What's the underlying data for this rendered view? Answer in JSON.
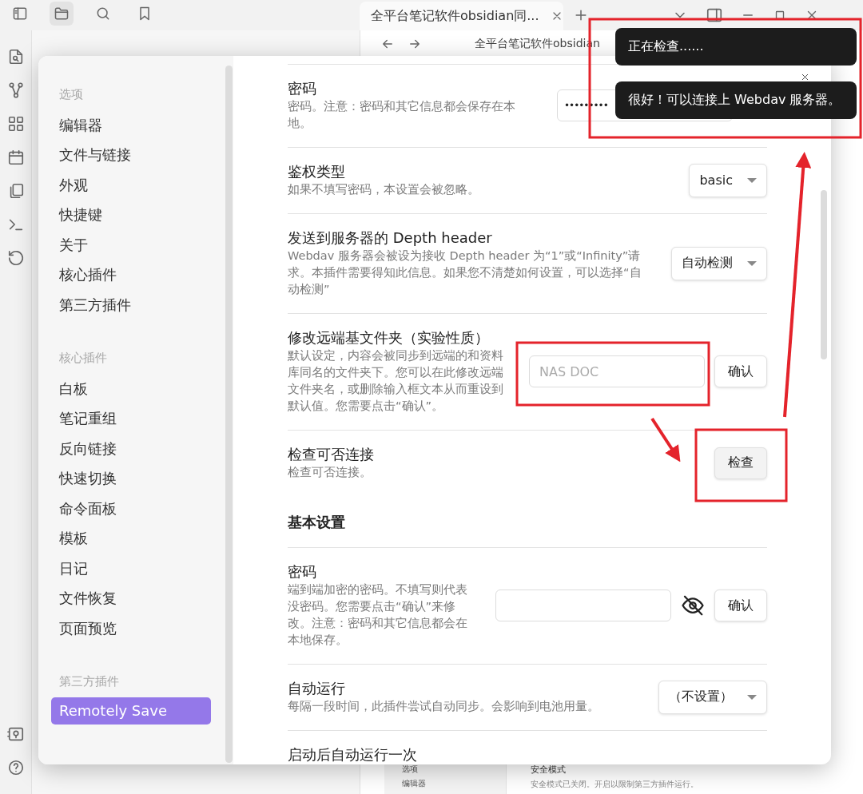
{
  "app": {
    "tab_title": "全平台笔记软件obsidian同...",
    "nav_title": "全平台笔记软件obsidian"
  },
  "settings_modal": {
    "sidebar": {
      "sections": [
        {
          "heading": "选项",
          "items": [
            {
              "label": "编辑器",
              "selected": false
            },
            {
              "label": "文件与链接",
              "selected": false
            },
            {
              "label": "外观",
              "selected": false
            },
            {
              "label": "快捷键",
              "selected": false
            },
            {
              "label": "关于",
              "selected": false
            },
            {
              "label": "核心插件",
              "selected": false
            },
            {
              "label": "第三方插件",
              "selected": false
            }
          ]
        },
        {
          "heading": "核心插件",
          "items": [
            {
              "label": "白板",
              "selected": false
            },
            {
              "label": "笔记重组",
              "selected": false
            },
            {
              "label": "反向链接",
              "selected": false
            },
            {
              "label": "快速切换",
              "selected": false
            },
            {
              "label": "命令面板",
              "selected": false
            },
            {
              "label": "模板",
              "selected": false
            },
            {
              "label": "日记",
              "selected": false
            },
            {
              "label": "文件恢复",
              "selected": false
            },
            {
              "label": "页面预览",
              "selected": false
            }
          ]
        },
        {
          "heading": "第三方插件",
          "items": [
            {
              "label": "Remotely Save",
              "selected": true
            }
          ]
        }
      ]
    },
    "content": [
      {
        "kind": "setting",
        "title": "密码",
        "description": "密码。注意：密码和其它信息都会保存在本地。",
        "controls": [
          {
            "kind": "password",
            "value": "•••••••••"
          }
        ]
      },
      {
        "kind": "setting",
        "title": "鉴权类型",
        "description": "如果不填写密码，本设置会被忽略。",
        "controls": [
          {
            "kind": "dropdown",
            "value": "basic"
          }
        ]
      },
      {
        "kind": "setting",
        "title": "发送到服务器的 Depth header",
        "description": "Webdav 服务器会被设为接收 Depth header 为“1”或“Infinity”请求。本插件需要得知此信息。如果您不清楚如何设置，可以选择“自动检测”",
        "controls": [
          {
            "kind": "dropdown",
            "value": "自动检测"
          }
        ]
      },
      {
        "kind": "setting",
        "title": "修改远端基文件夹（实验性质）",
        "description": "默认设定，内容会被同步到远端的和资料库同名的文件夹下。您可以在此修改远端文件夹名，或删除输入框文本从而重设到默认值。您需要点击“确认”。",
        "controls": [
          {
            "kind": "text",
            "placeholder": "NAS DOC"
          },
          {
            "kind": "button",
            "label": "确认"
          }
        ]
      },
      {
        "kind": "setting",
        "title": "检查可否连接",
        "description": "检查可否连接。",
        "controls": [
          {
            "kind": "button",
            "label": "检查"
          }
        ]
      },
      {
        "kind": "heading",
        "title": "基本设置"
      },
      {
        "kind": "setting",
        "title": "密码",
        "description": "端到端加密的密码。不填写则代表没密码。您需要点击“确认”来修改。注意：密码和其它信息都会在本地保存。",
        "controls": [
          {
            "kind": "text"
          },
          {
            "kind": "eye_off"
          },
          {
            "kind": "button",
            "label": "确认"
          }
        ]
      },
      {
        "kind": "setting",
        "title": "自动运行",
        "description": "每隔一段时间，此插件尝试自动同步。会影响到电池用量。",
        "controls": [
          {
            "kind": "dropdown",
            "value": "（不设置）"
          }
        ]
      },
      {
        "kind": "setting",
        "title": "启动后自动运行一次"
      }
    ]
  },
  "toasts": [
    "正在检查......",
    "很好！可以连接上 Webdav 服务器。"
  ],
  "background_settings": {
    "sidebar_items": [
      "选项",
      "编辑器"
    ],
    "title": "安全模式",
    "description": "安全模式已关闭。开启以限制第三方插件运行。"
  }
}
